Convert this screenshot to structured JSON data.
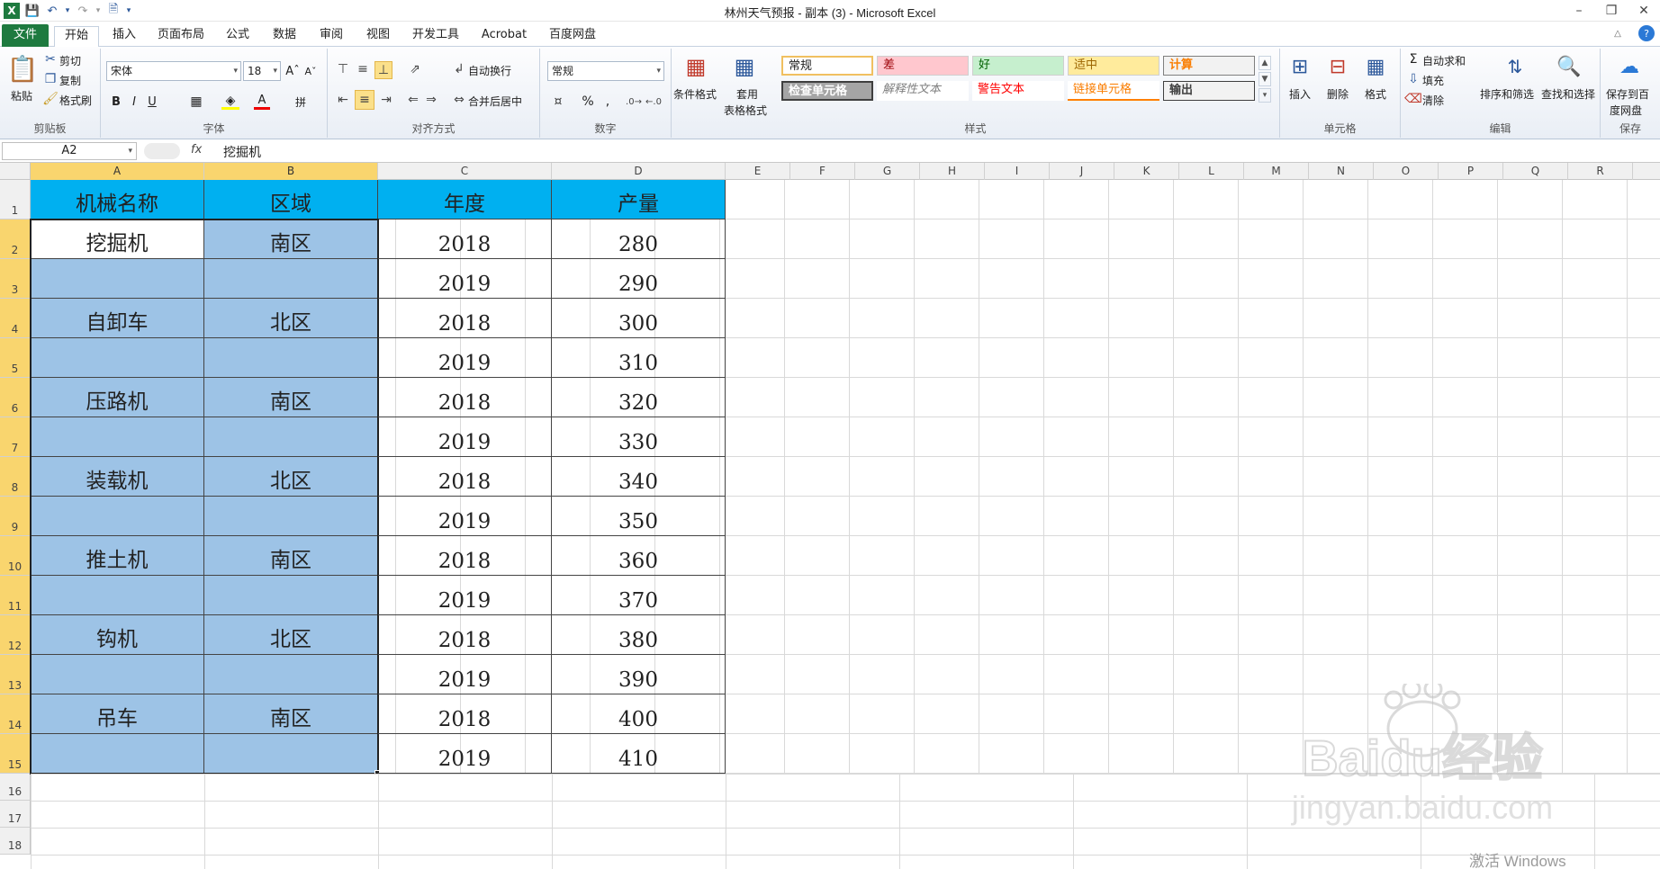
{
  "window": {
    "title": "林州天气预报 - 副本 (3)  -  Microsoft Excel"
  },
  "tabs": [
    "文件",
    "开始",
    "插入",
    "页面布局",
    "公式",
    "数据",
    "审阅",
    "视图",
    "开发工具",
    "Acrobat",
    "百度网盘"
  ],
  "ribbon": {
    "clipboard": {
      "paste": "粘贴",
      "cut": "剪切",
      "copy": "复制",
      "format_painter": "格式刷",
      "label": "剪贴板"
    },
    "font": {
      "name": "宋体",
      "size": "18",
      "label": "字体"
    },
    "alignment": {
      "wrap": "自动换行",
      "merge": "合并后居中",
      "label": "对齐方式"
    },
    "number": {
      "format": "常规",
      "label": "数字"
    },
    "styles": {
      "cond_format": "条件格式",
      "table_format_1": "套用",
      "table_format_2": "表格格式",
      "label": "样式",
      "cells": [
        "常规",
        "差",
        "好",
        "适中",
        "计算",
        "检查单元格",
        "解释性文本",
        "警告文本",
        "链接单元格",
        "输出"
      ]
    },
    "cells": {
      "insert": "插入",
      "delete": "删除",
      "format": "格式",
      "label": "单元格"
    },
    "editing": {
      "autosum": "自动求和",
      "fill": "填充",
      "clear": "清除",
      "sort": "排序和筛选",
      "find": "查找和选择",
      "label": "编辑"
    },
    "save": {
      "save_1": "保存到百",
      "save_2": "度网盘",
      "label": "保存"
    }
  },
  "formula_bar": {
    "name_box": "A2",
    "fx": "fx",
    "content": "挖掘机"
  },
  "columns": [
    "A",
    "B",
    "C",
    "D",
    "E",
    "F",
    "G",
    "H",
    "I",
    "J",
    "K",
    "L",
    "M",
    "N",
    "O",
    "P",
    "Q",
    "R"
  ],
  "rows": [
    "1",
    "2",
    "3",
    "4",
    "5",
    "6",
    "7",
    "8",
    "9",
    "10",
    "11",
    "12",
    "13",
    "14",
    "15",
    "16",
    "17",
    "18"
  ],
  "table": {
    "headers": [
      "机械名称",
      "区域",
      "年度",
      "产量"
    ],
    "machines": [
      "挖掘机",
      "自卸车",
      "压路机",
      "装载机",
      "推土机",
      "钩机",
      "吊车"
    ],
    "regions": [
      "南区",
      "北区",
      "南区",
      "北区",
      "南区",
      "北区",
      "南区"
    ],
    "years": [
      "2018",
      "2019",
      "2018",
      "2019",
      "2018",
      "2019",
      "2018",
      "2019",
      "2018",
      "2019",
      "2018",
      "2019",
      "2018",
      "2019"
    ],
    "output": [
      "280",
      "290",
      "300",
      "310",
      "320",
      "330",
      "340",
      "350",
      "360",
      "370",
      "380",
      "390",
      "400",
      "410"
    ]
  },
  "watermark": {
    "logo": "Baidu经验",
    "url": "jingyan.baidu.com"
  },
  "activate": "激活 Windows",
  "colors": {
    "header": "#00b0f0",
    "selection": "#9dc3e6",
    "file_tab": "#1e7a3f",
    "col_header_sel": "#f9d56e"
  }
}
